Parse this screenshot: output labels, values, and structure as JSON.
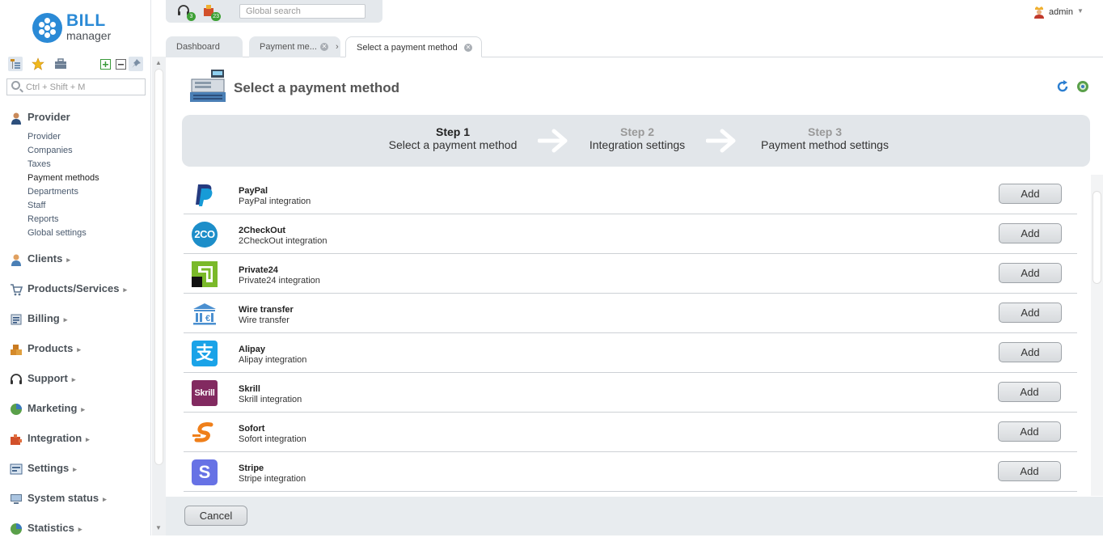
{
  "brand": {
    "name_top": "BILL",
    "name_bottom": "manager",
    "color": "#2b8ad6"
  },
  "topbar": {
    "support_badge": "3",
    "tasks_badge": "23",
    "search_placeholder": "Global search"
  },
  "user": {
    "name": "admin"
  },
  "sidebar": {
    "search_placeholder": "Ctrl + Shift + M",
    "groups": [
      {
        "label": "Provider",
        "icon": "user-icon",
        "expanded": true,
        "items": [
          "Provider",
          "Companies",
          "Taxes",
          "Payment methods",
          "Departments",
          "Staff",
          "Reports",
          "Global settings"
        ]
      },
      {
        "label": "Clients",
        "icon": "clients-icon"
      },
      {
        "label": "Products/Services",
        "icon": "cart-icon"
      },
      {
        "label": "Billing",
        "icon": "billing-icon"
      },
      {
        "label": "Products",
        "icon": "boxes-icon"
      },
      {
        "label": "Support",
        "icon": "headset-icon"
      },
      {
        "label": "Marketing",
        "icon": "pie-icon"
      },
      {
        "label": "Integration",
        "icon": "puzzle-icon"
      },
      {
        "label": "Settings",
        "icon": "settings-icon"
      },
      {
        "label": "System status",
        "icon": "monitor-icon"
      },
      {
        "label": "Statistics",
        "icon": "chart-icon"
      }
    ]
  },
  "tabs": [
    {
      "label": "Dashboard"
    },
    {
      "label": "Payment me..."
    },
    {
      "label": "Select a payment method"
    }
  ],
  "page": {
    "title": "Select a payment method"
  },
  "steps": [
    {
      "num": "Step 1",
      "title": "Select a payment method"
    },
    {
      "num": "Step 2",
      "title": "Integration settings"
    },
    {
      "num": "Step 3",
      "title": "Payment method settings"
    }
  ],
  "methods": [
    {
      "name": "PayPal",
      "desc": "PayPal integration",
      "icon": "paypal-logo",
      "add": "Add"
    },
    {
      "name": "2CheckOut",
      "desc": "2CheckOut integration",
      "icon": "2checkout-logo",
      "add": "Add"
    },
    {
      "name": "Private24",
      "desc": "Private24 integration",
      "icon": "privat24-logo",
      "add": "Add"
    },
    {
      "name": "Wire transfer",
      "desc": "Wire transfer",
      "icon": "bank-icon",
      "add": "Add"
    },
    {
      "name": "Alipay",
      "desc": "Alipay integration",
      "icon": "alipay-logo",
      "add": "Add"
    },
    {
      "name": "Skrill",
      "desc": "Skrill integration",
      "icon": "skrill-logo",
      "add": "Add"
    },
    {
      "name": "Sofort",
      "desc": "Sofort integration",
      "icon": "sofort-logo",
      "add": "Add"
    },
    {
      "name": "Stripe",
      "desc": "Stripe integration",
      "icon": "stripe-logo",
      "add": "Add"
    }
  ],
  "logos": {
    "twoco_text": "2CO",
    "skrill_text": "Skrill",
    "stripe_text": "S",
    "alipay_text": "支"
  },
  "footer": {
    "cancel": "Cancel"
  }
}
